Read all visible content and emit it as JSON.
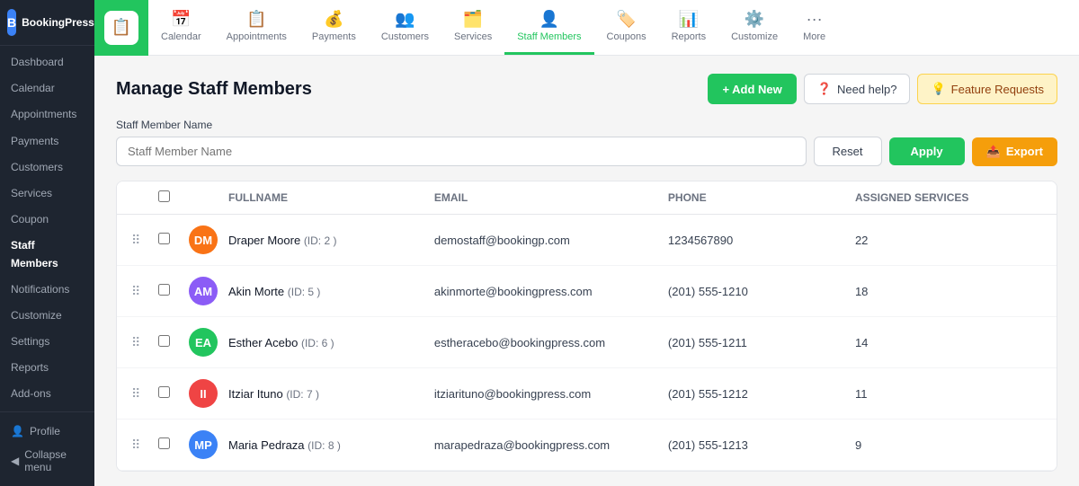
{
  "sidebar": {
    "logo_text": "BookingPress",
    "nav_items": [
      {
        "label": "Dashboard",
        "active": false
      },
      {
        "label": "Calendar",
        "active": false
      },
      {
        "label": "Appointments",
        "active": false
      },
      {
        "label": "Payments",
        "active": false
      },
      {
        "label": "Customers",
        "active": false
      },
      {
        "label": "Services",
        "active": false
      },
      {
        "label": "Coupon",
        "active": false
      },
      {
        "label": "Staff Members",
        "active": true
      },
      {
        "label": "Notifications",
        "active": false
      },
      {
        "label": "Customize",
        "active": false
      },
      {
        "label": "Settings",
        "active": false
      },
      {
        "label": "Reports",
        "active": false
      },
      {
        "label": "Add-ons",
        "active": false
      }
    ],
    "profile_label": "Profile",
    "collapse_label": "Collapse menu"
  },
  "topnav": {
    "items": [
      {
        "label": "Calendar",
        "icon": "📅",
        "active": false
      },
      {
        "label": "Appointments",
        "icon": "📋",
        "active": false
      },
      {
        "label": "Payments",
        "icon": "💰",
        "active": false
      },
      {
        "label": "Customers",
        "icon": "👥",
        "active": false
      },
      {
        "label": "Services",
        "icon": "🗂️",
        "active": false
      },
      {
        "label": "Staff Members",
        "icon": "👤",
        "active": true
      },
      {
        "label": "Coupons",
        "icon": "🏷️",
        "active": false
      },
      {
        "label": "Reports",
        "icon": "📊",
        "active": false
      },
      {
        "label": "Customize",
        "icon": "⚙️",
        "active": false
      },
      {
        "label": "More",
        "icon": "···",
        "active": false
      }
    ]
  },
  "page": {
    "title": "Manage Staff Members",
    "add_new_label": "+ Add New",
    "need_help_label": "Need help?",
    "feature_requests_label": "Feature Requests",
    "filter": {
      "label": "Staff Member Name",
      "placeholder": "Staff Member Name",
      "reset_label": "Reset",
      "apply_label": "Apply",
      "export_label": "Export"
    },
    "table": {
      "columns": {
        "fullname": "FullName",
        "email": "Email",
        "phone": "Phone",
        "assigned_services": "Assigned Services"
      },
      "rows": [
        {
          "id": "2",
          "name": "Draper Moore",
          "email": "demostaff@bookingp.com",
          "phone": "1234567890",
          "services": "22",
          "initials": "DM",
          "color": "#f97316"
        },
        {
          "id": "5",
          "name": "Akin Morte",
          "email": "akinmorte@bookingpress.com",
          "phone": "(201) 555-1210",
          "services": "18",
          "initials": "AM",
          "color": "#8b5cf6"
        },
        {
          "id": "6",
          "name": "Esther Acebo",
          "email": "estheracebo@bookingpress.com",
          "phone": "(201) 555-1211",
          "services": "14",
          "initials": "EA",
          "color": "#22c55e"
        },
        {
          "id": "7",
          "name": "Itziar Ituno",
          "email": "itziarituno@bookingpress.com",
          "phone": "(201) 555-1212",
          "services": "11",
          "initials": "II",
          "color": "#ef4444"
        },
        {
          "id": "8",
          "name": "Maria Pedraza",
          "email": "marapedraza@bookingpress.com",
          "phone": "(201) 555-1213",
          "services": "9",
          "initials": "MP",
          "color": "#3b82f6"
        }
      ]
    }
  }
}
